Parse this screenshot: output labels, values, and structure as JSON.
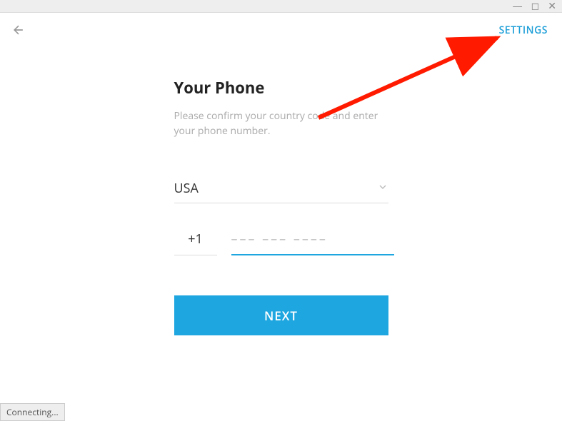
{
  "header": {
    "settings_label": "SETTINGS"
  },
  "form": {
    "title": "Your Phone",
    "subtitle": "Please confirm your country code and enter your phone number.",
    "country_value": "USA",
    "code_value": "+1",
    "phone_placeholder": "––– ––– ––––",
    "next_label": "NEXT"
  },
  "status": {
    "text": "Connecting..."
  },
  "colors": {
    "accent": "#1ea6e0",
    "link": "#1e9fd8"
  }
}
